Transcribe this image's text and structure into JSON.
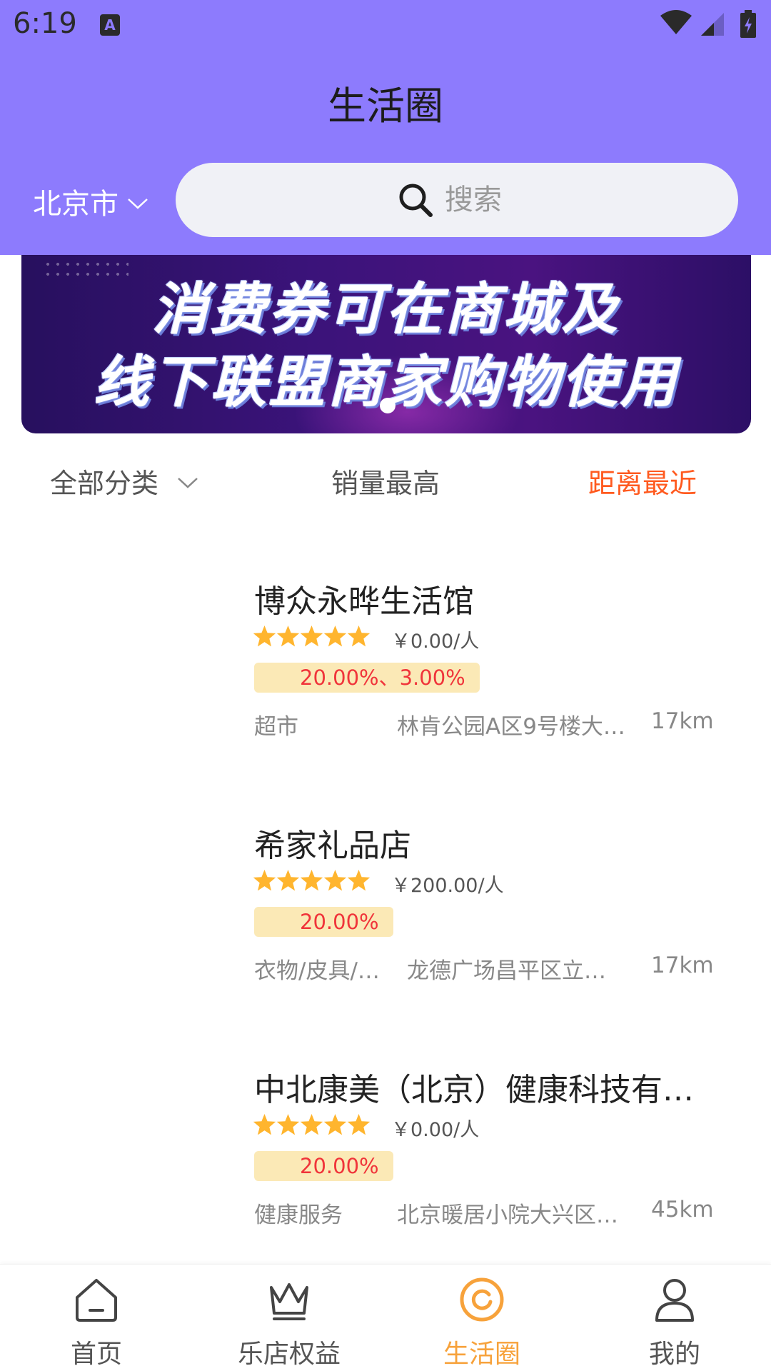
{
  "status_bar": {
    "time": "6:19",
    "notification_icon": "A"
  },
  "header": {
    "title": "生活圈",
    "city": "北京市",
    "search_placeholder": "搜索"
  },
  "banner": {
    "line1": "消费券可在商城及",
    "line2": "线下联盟商家购物使用"
  },
  "filters": {
    "all_categories": "全部分类",
    "top_sales": "销量最高",
    "nearest": "距离最近",
    "active_color": "#ff5a1f"
  },
  "shops": [
    {
      "name": "博众永晔生活馆",
      "rating": 5,
      "price": "￥0.00/人",
      "discount": "20.00%、3.00%",
      "category": "超市",
      "address": "林肯公园A区9号楼大…",
      "distance": "17km"
    },
    {
      "name": "希家礼品店",
      "rating": 5,
      "price": "￥200.00/人",
      "discount": "20.00%",
      "category": "衣物/皮具/…",
      "address": "龙德广场昌平区立…",
      "distance": "17km"
    },
    {
      "name": "中北康美（北京）健康科技有…",
      "rating": 5,
      "price": "￥0.00/人",
      "discount": "20.00%",
      "category": "健康服务",
      "address": "北京暖居小院大兴区…",
      "distance": "45km"
    }
  ],
  "bottom_nav": {
    "items": [
      {
        "label": "首页",
        "icon": "home-icon"
      },
      {
        "label": "乐店权益",
        "icon": "crown-icon"
      },
      {
        "label": "生活圈",
        "icon": "life-circle-icon",
        "active": true
      },
      {
        "label": "我的",
        "icon": "user-icon"
      }
    ],
    "active_color": "#f7a23b"
  },
  "colors": {
    "header_bg": "#8d7bfd",
    "star": "#ffb52e",
    "discount_bg": "#fbe9b6",
    "discount_text": "#f0343a"
  }
}
